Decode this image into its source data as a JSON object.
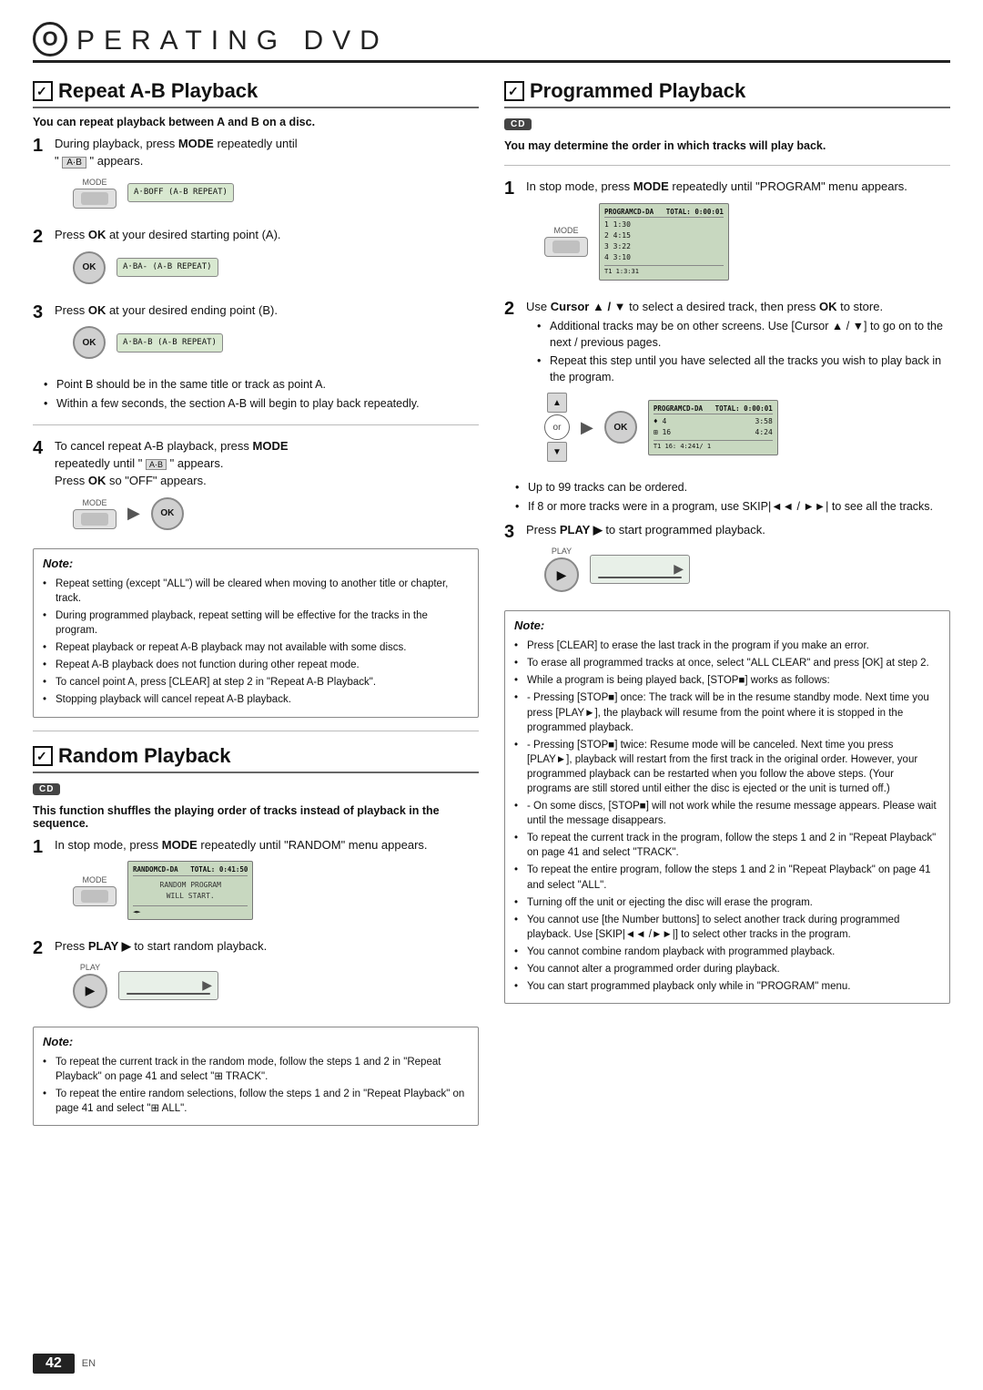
{
  "header": {
    "letter": "O",
    "title": "PERATING   DVD"
  },
  "left_col": {
    "section1": {
      "heading": "Repeat A-B Playback",
      "subtitle": "You can repeat playback between A and B on a disc.",
      "steps": [
        {
          "num": "1",
          "text": "During playback, press ",
          "bold": "MODE",
          "text2": " repeatedly until",
          "text3": "\" \" appears."
        },
        {
          "num": "2",
          "text": "Press ",
          "bold": "OK",
          "text2": " at your desired starting point (A)."
        },
        {
          "num": "3",
          "text": "Press ",
          "bold": "OK",
          "text2": " at your desired ending point (B)."
        }
      ],
      "bullets_after_3": [
        "Point B should be in the same title or track as point A.",
        "Within a few seconds, the section A-B will begin to play back repeatedly."
      ],
      "step4": {
        "num": "4",
        "text": "To cancel repeat A-B playback, press ",
        "bold": "MODE",
        "text2": " repeatedly until \" \" appears.",
        "text3": "Press ",
        "bold2": "OK",
        "text4": " so \"OFF\" appears."
      },
      "note_title": "Note:",
      "notes": [
        "Repeat setting (except \"ALL\") will be cleared when moving to another title or chapter, track.",
        "During programmed playback, repeat setting will be effective for the tracks in the program.",
        "Repeat playback or repeat A-B playback may not available with some discs.",
        "Repeat A-B playback does not function during other repeat mode.",
        "To cancel point A, press [CLEAR] at step 2 in \"Repeat A-B Playback\".",
        "Stopping playback will cancel repeat A-B playback."
      ]
    },
    "section2": {
      "heading": "Random Playback",
      "cd_badge": "CD",
      "subtitle": "This function shuffles the playing order of tracks instead of playback in the sequence.",
      "steps": [
        {
          "num": "1",
          "text": "In stop mode, press ",
          "bold": "MODE",
          "text2": " repeatedly until \"RANDOM\" menu appears."
        },
        {
          "num": "2",
          "text": "Press ",
          "bold": "PLAY ▶",
          "text2": " to start random playback."
        }
      ],
      "note_title": "Note:",
      "notes": [
        "To repeat the current track in the random mode, follow the steps 1 and 2 in \"Repeat Playback\" on page 41 and select \"⊞ TRACK\".",
        "To repeat the entire random selections, follow the steps 1 and 2 in \"Repeat Playback\" on page 41 and select \"⊞ ALL\"."
      ]
    }
  },
  "right_col": {
    "section1": {
      "heading": "Programmed Playback",
      "cd_badge": "CD",
      "subtitle": "You may determine the order in which tracks will play back.",
      "steps": [
        {
          "num": "1",
          "text": "In stop mode, press ",
          "bold": "MODE",
          "text2": " repeatedly until \"PROGRAM\" menu appears."
        },
        {
          "num": "2",
          "text": "Use ",
          "bold1": "Cursor ▲ / ▼",
          "text2": " to select a desired track, then press ",
          "bold2": "OK",
          "text3": " to store.",
          "bullets": [
            "Additional tracks may be on other screens. Use [Cursor ▲ / ▼] to go on to the next / previous pages.",
            "Repeat this step until you have selected all the tracks you wish to play back in the program."
          ]
        },
        {
          "num": "3",
          "text": "Press ",
          "bold": "PLAY ▶",
          "text2": " to start programmed playback."
        }
      ],
      "bullets_after_2": [
        "Up to 99 tracks can be ordered.",
        "If 8 or more tracks were in a program, use SKIP|◄◄ / ►►| to see all the tracks."
      ],
      "note_title": "Note:",
      "notes": [
        "Press [CLEAR] to erase the last track in the program if you make an error.",
        "To erase all programmed tracks at once, select \"ALL CLEAR\" and press [OK] at step 2.",
        "While a program is being played back, [STOP■] works as follows:",
        "- Pressing [STOP■] once: The track will be in the resume standby mode. Next time you press [PLAY►], the playback will resume from the point where it is stopped in the programmed playback.",
        "- Pressing [STOP■] twice: Resume mode will be canceled. Next time you press [PLAY►], playback will restart from the first track in the original order. However, your programmed playback can be restarted when you follow the above steps. (Your programs are still stored until either the disc is ejected or the unit is turned off.)",
        "- On some discs, [STOP■] will not work while the resume message appears. Please wait until the message disappears.",
        "To repeat the current track in the program, follow the steps 1 and 2 in \"Repeat Playback\" on page 41 and select \"TRACK\".",
        "To repeat the entire program, follow the steps 1 and 2 in \"Repeat Playback\" on page 41 and select \"ALL\".",
        "Turning off the unit or ejecting the disc will erase the program.",
        "You cannot use [the Number buttons] to select another track during programmed playback. Use [SKIP|◄◄ /►►|] to select other tracks in the program.",
        "You cannot combine random playback with programmed playback.",
        "You cannot alter a programmed order during playback.",
        "You can start programmed playback only while in \"PROGRAM\" menu."
      ]
    }
  },
  "footer": {
    "page_num": "42",
    "lang": "EN"
  }
}
